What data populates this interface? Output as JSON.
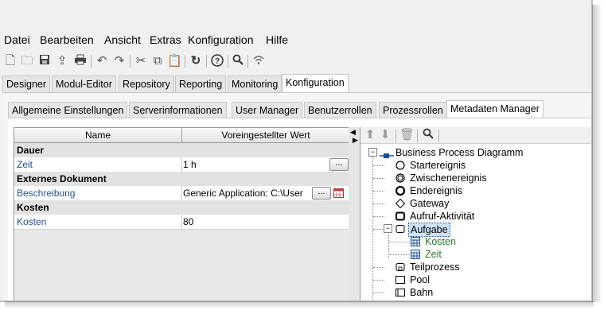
{
  "menu": [
    "Datei",
    "Bearbeiten",
    "Ansicht",
    "Extras",
    "Konfiguration",
    "Hilfe"
  ],
  "toolbar_icons": [
    "new-icon",
    "open-icon",
    "save-icon",
    "export-icon",
    "print-icon",
    "undo-icon",
    "redo-icon",
    "cut-icon",
    "copy-icon",
    "paste-icon",
    "refresh-icon",
    "help-icon",
    "search-icon",
    "wireless-icon"
  ],
  "main_tabs": [
    "Designer",
    "Modul-Editor",
    "Repository",
    "Reporting",
    "Monitoring",
    "Konfiguration"
  ],
  "main_tab_active": "Konfiguration",
  "sub_tabs": [
    "Allgemeine Einstellungen",
    "Serverinformationen",
    "User Manager",
    "Benutzerrollen",
    "Prozessrollen",
    "Metadaten Manager"
  ],
  "sub_tab_active": "Metadaten Manager",
  "grid": {
    "headers": {
      "name": "Name",
      "value": "Voreingestellter Wert"
    },
    "rows": [
      {
        "type": "group",
        "name": "Dauer",
        "value": ""
      },
      {
        "type": "prop",
        "name": "Zeit",
        "value": "1 h"
      },
      {
        "type": "group",
        "name": "Externes Dokument",
        "value": ""
      },
      {
        "type": "prop",
        "name": "Beschreibung",
        "value": "Generic Application: C:\\User"
      },
      {
        "type": "group",
        "name": "Kosten",
        "value": ""
      },
      {
        "type": "prop",
        "name": "Kosten",
        "value": "80"
      }
    ],
    "ellipsis_label": "...",
    "expand_arrow": "◀"
  },
  "tree": {
    "root": "Business Process Diagramm",
    "items": [
      "Startereignis",
      "Zwischenereignis",
      "Endereignis",
      "Gateway",
      "Aufruf-Aktivität",
      "Aufgabe",
      "Teilprozess",
      "Pool",
      "Bahn"
    ],
    "selected": "Aufgabe",
    "children": [
      "Kosten",
      "Zeit"
    ],
    "expand_collapse": "−",
    "child_color": "#2a7a2a",
    "selected_bg": "#cde3f7"
  }
}
